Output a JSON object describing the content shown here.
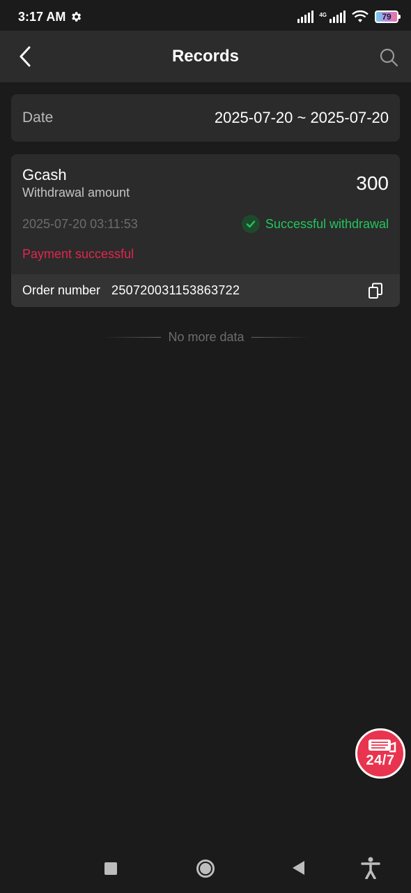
{
  "status_bar": {
    "time": "3:17 AM",
    "network_label": "4G",
    "battery": "79"
  },
  "header": {
    "title": "Records"
  },
  "date_filter": {
    "label": "Date",
    "value": "2025-07-20 ~ 2025-07-20"
  },
  "records": [
    {
      "method": "Gcash",
      "type": "Withdrawal amount",
      "amount": "300",
      "time": "2025-07-20 03:11:53",
      "status": "Successful withdrawal",
      "payment_status": "Payment successful",
      "order_label": "Order number",
      "order_number": "250720031153863722"
    }
  ],
  "list_end_text": "No more data",
  "support_badge": "24/7",
  "colors": {
    "background": "#1b1b1b",
    "card": "#2b2b2b",
    "success": "#22c55e",
    "payment": "#e0264f",
    "support": "#e8344f"
  },
  "icons": {
    "back": "chevron-left-icon",
    "search": "search-icon",
    "status_check": "check-circle-icon",
    "copy": "copy-icon",
    "support": "chat-support-icon"
  }
}
